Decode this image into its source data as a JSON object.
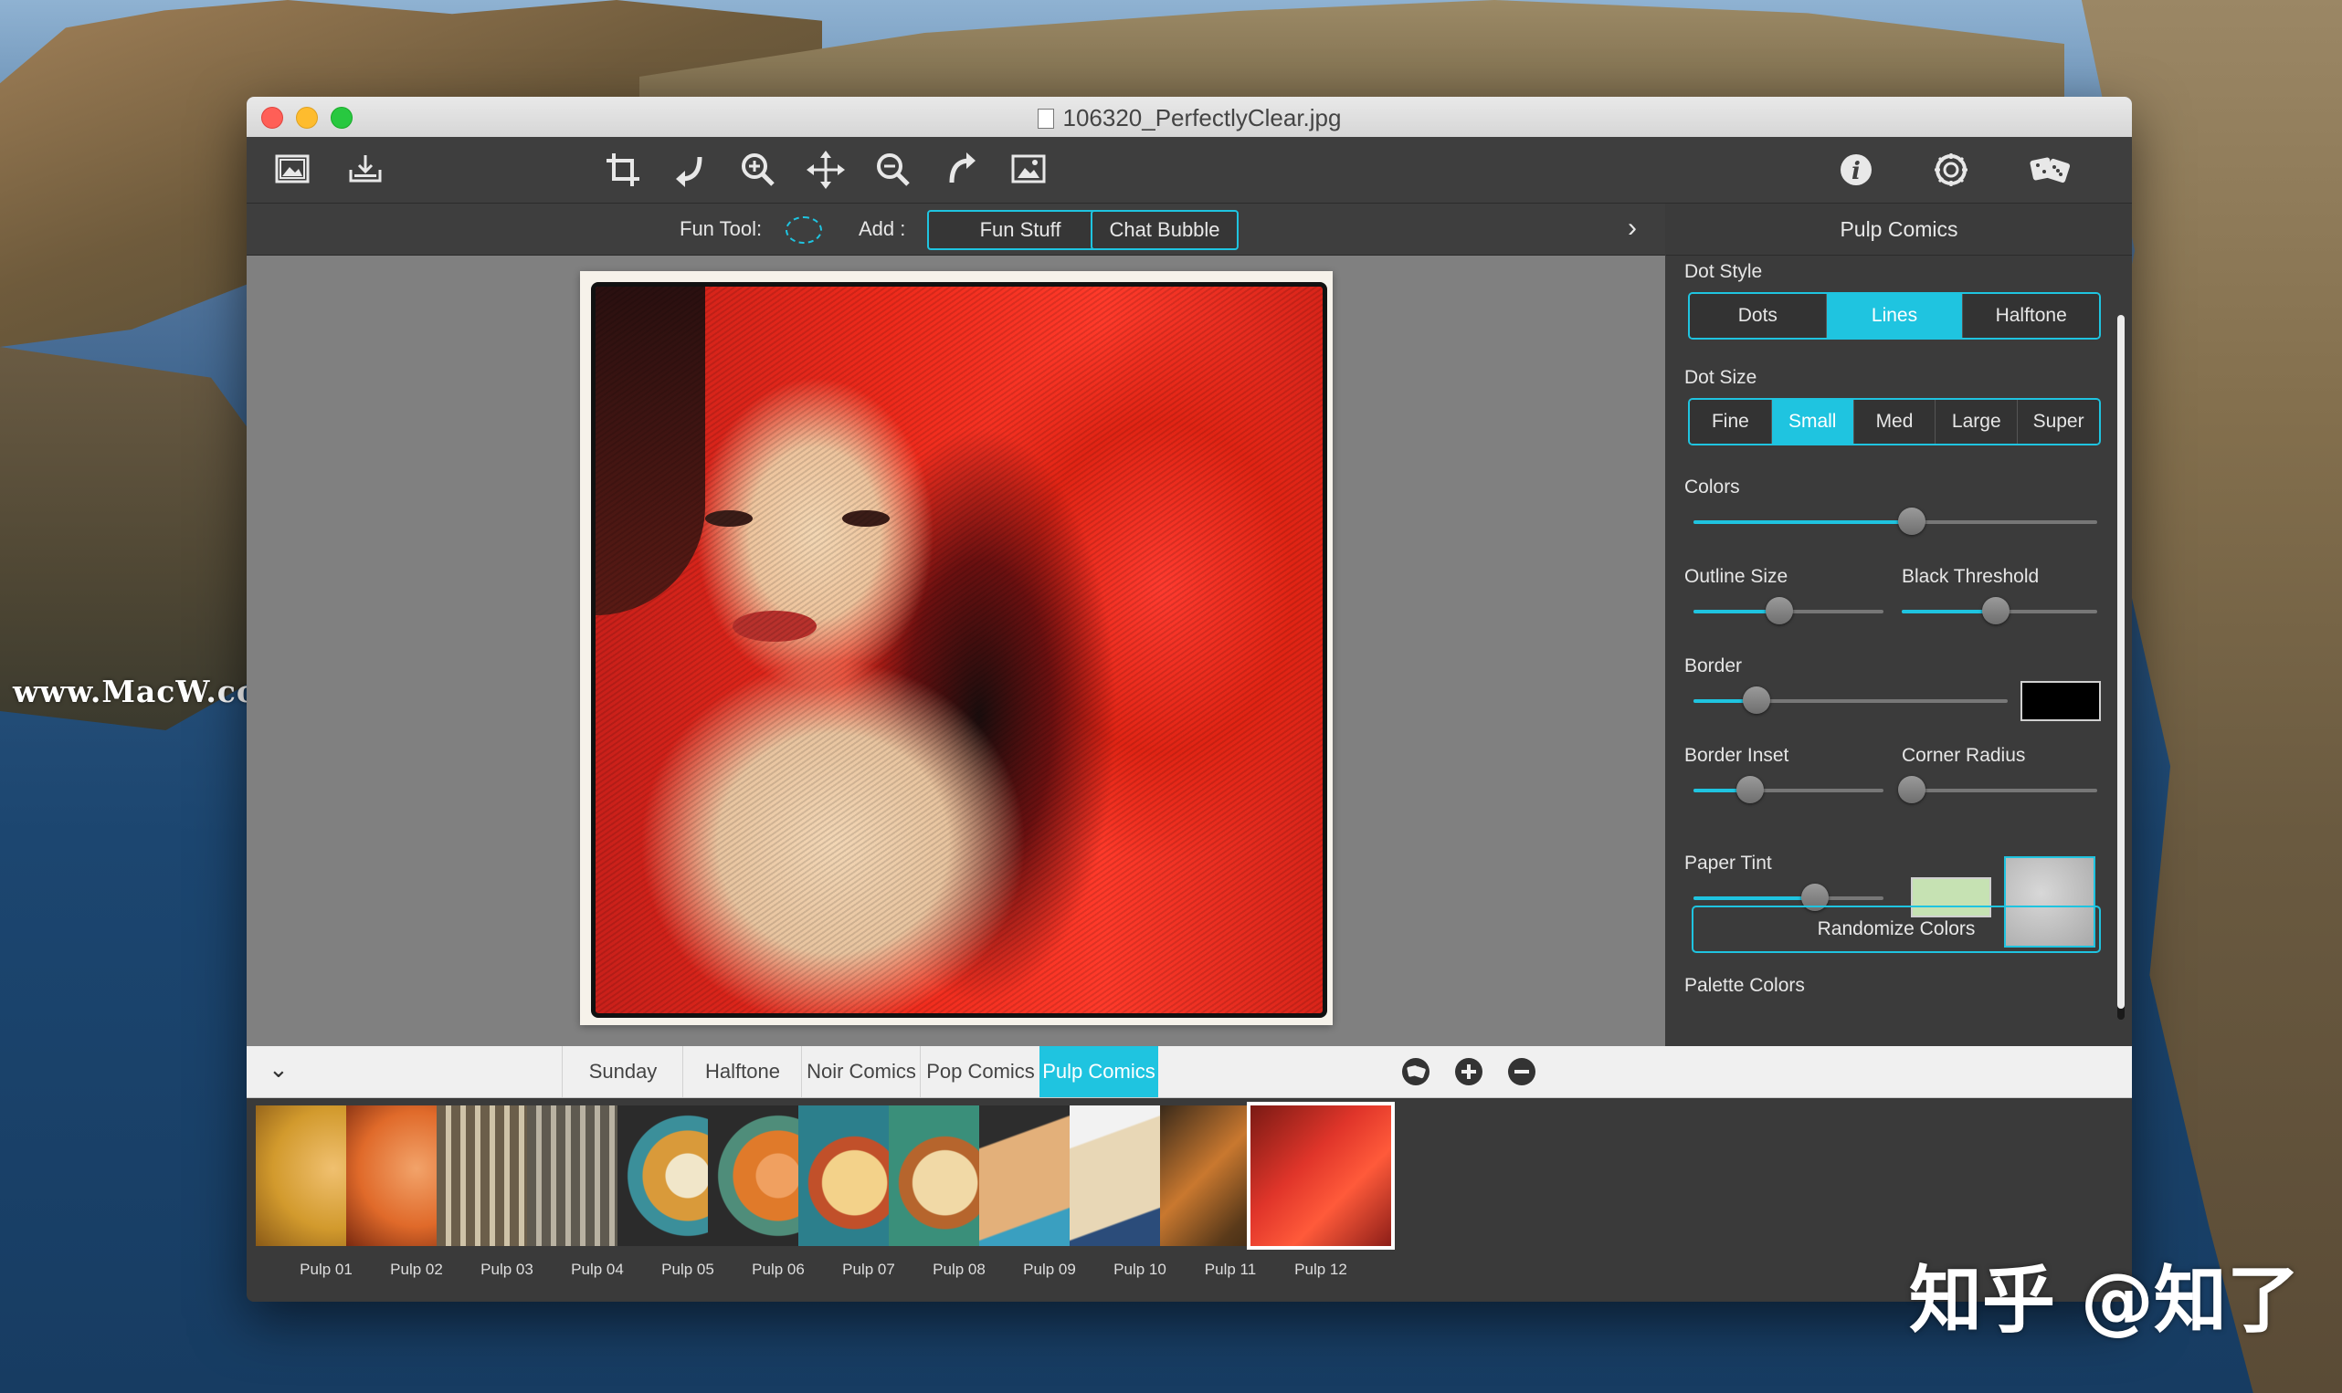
{
  "window": {
    "title": "106320_PerfectlyClear.jpg"
  },
  "watermarks": {
    "left": "www.MacW.com",
    "right": "知乎 @知了"
  },
  "toolbar": {
    "icons": [
      "open-image-icon",
      "save-icon",
      "crop-icon",
      "undo-icon",
      "zoom-in-icon",
      "move-icon",
      "zoom-out-icon",
      "redo-icon",
      "compare-image-icon",
      "info-icon",
      "settings-icon",
      "randomize-icon"
    ]
  },
  "funbar": {
    "fun_tool_label": "Fun Tool:",
    "add_label": "Add :",
    "fun_stuff": "Fun Stuff",
    "chat_bubble": "Chat Bubble",
    "expand_glyph": "›"
  },
  "panel": {
    "title": "Pulp Comics",
    "dot_style": {
      "label": "Dot Style",
      "options": [
        "Dots",
        "Lines",
        "Halftone"
      ],
      "selected": "Lines"
    },
    "dot_size": {
      "label": "Dot Size",
      "options": [
        "Fine",
        "Small",
        "Med",
        "Large",
        "Super"
      ],
      "selected": "Small"
    },
    "colors": {
      "label": "Colors",
      "value": 0.54
    },
    "outline_size": {
      "label": "Outline Size",
      "value": 0.45
    },
    "black_threshold": {
      "label": "Black Threshold",
      "value": 0.48
    },
    "border": {
      "label": "Border",
      "value": 0.2,
      "color": "#000000"
    },
    "border_inset": {
      "label": "Border Inset",
      "value": 0.3
    },
    "corner_radius": {
      "label": "Corner Radius",
      "value": 0.05
    },
    "paper_tint": {
      "label": "Paper Tint",
      "value": 0.64,
      "color": "#c6e2b3"
    },
    "randomize": "Randomize Colors",
    "palette_label": "Palette Colors"
  },
  "presets": {
    "tabs": [
      "Sunday Comics",
      "Halftone",
      "Noir Comics",
      "Pop Comics",
      "Pulp Comics"
    ],
    "selected_tab": "Pulp Comics",
    "items": [
      "Pulp 01",
      "Pulp 02",
      "Pulp 03",
      "Pulp 04",
      "Pulp 05",
      "Pulp 06",
      "Pulp 07",
      "Pulp 08",
      "Pulp 09",
      "Pulp 10",
      "Pulp 11",
      "Pulp 12"
    ],
    "selected_item": "Pulp 12"
  },
  "colors": {
    "accent": "#1fc4e0"
  }
}
